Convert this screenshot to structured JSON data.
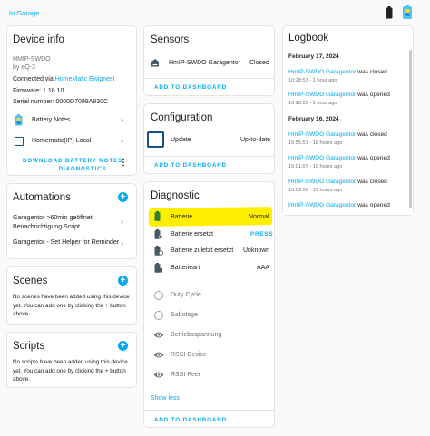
{
  "topbar": {
    "back_label": "In Garage"
  },
  "device_info": {
    "title": "Device info",
    "model": "HMIP-SWDO",
    "manufacturer": "by eQ-3",
    "connected_prefix": "Connected via",
    "connected_link": "HomeMatic Ewignest",
    "firmware": "Firmware: 1.18.10",
    "serial": "Serial number: 0000D7099A830C",
    "items": [
      {
        "label": "Battery Notes"
      },
      {
        "label": "Homematic(IP) Local"
      }
    ],
    "download_button": "DOWNLOAD BATTERY NOTES DIAGNOSTICS",
    "download_line1": "DOWNLOAD BATTERY NOTES",
    "download_line2": "DIAGNOSTICS"
  },
  "automations": {
    "title": "Automations",
    "items": [
      {
        "line1": "Garagentor >60min geöffnet",
        "line2": "Benachrichtigung Script"
      },
      {
        "line1": "Garagentor - Set Helper for Reminder"
      }
    ]
  },
  "scenes": {
    "title": "Scenes",
    "empty_line1": "No scenes have been added using this device",
    "empty_line2": "yet. You can add one by clicking the + button",
    "empty_line3": "above."
  },
  "scripts": {
    "title": "Scripts",
    "empty_line1": "No scripts have been added using this device",
    "empty_line2": "yet. You can add one by clicking the + button",
    "empty_line3": "above."
  },
  "sensors": {
    "title": "Sensors",
    "entity_name": "HmIP-SWDO Garagentor",
    "entity_state": "Closed",
    "add_button": "ADD TO DASHBOARD"
  },
  "configuration": {
    "title": "Configuration",
    "entity_name": "Update",
    "entity_state": "Up-to-date",
    "add_button": "ADD TO DASHBOARD"
  },
  "diagnostic": {
    "title": "Diagnostic",
    "rows": [
      {
        "name": "Batterie",
        "state": "Normal"
      },
      {
        "name": "Batterie ersetzt",
        "state": "PRESS"
      },
      {
        "name": "Batterie zuletzt ersetzt",
        "state": "Unknown"
      },
      {
        "name": "Batterieart",
        "state": "AAA"
      },
      {
        "name": "Duty Cycle",
        "state": ""
      },
      {
        "name": "Sabotage",
        "state": ""
      },
      {
        "name": "Betriebsspannung",
        "state": ""
      },
      {
        "name": "RSSI Device",
        "state": ""
      },
      {
        "name": "RSSI Peer",
        "state": ""
      }
    ],
    "show_less": "Show less",
    "add_button": "ADD TO DASHBOARD"
  },
  "logbook": {
    "title": "Logbook",
    "groups": [
      {
        "date": "February 17, 2024",
        "entries": [
          {
            "entity": "HmIP-SWDO Garagentor",
            "action": " was closed",
            "time": "10:28:53 - 1 hour ago"
          },
          {
            "entity": "HmIP-SWDO Garagentor",
            "action": " was opened",
            "time": "10:28:25 - 1 hour ago"
          }
        ]
      },
      {
        "date": "February 16, 2024",
        "entries": [
          {
            "entity": "HmIP-SWDO Garagentor",
            "action": " was closed",
            "time": "16:55:51 - 18 hours ago"
          },
          {
            "entity": "HmIP-SWDO Garagentor",
            "action": " was opened",
            "time": "16:01:07 - 19 hours ago"
          },
          {
            "entity": "HmIP-SWDO Garagentor",
            "action": " was closed",
            "time": "15:59:06 - 19 hours ago"
          },
          {
            "entity": "HmIP-SWDO Garagentor",
            "action": " was opened",
            "time": ""
          }
        ]
      }
    ]
  },
  "colors": {
    "accent": "#03a9f4",
    "highlight": "#ffee00",
    "battery_green": "#2e7d32"
  }
}
